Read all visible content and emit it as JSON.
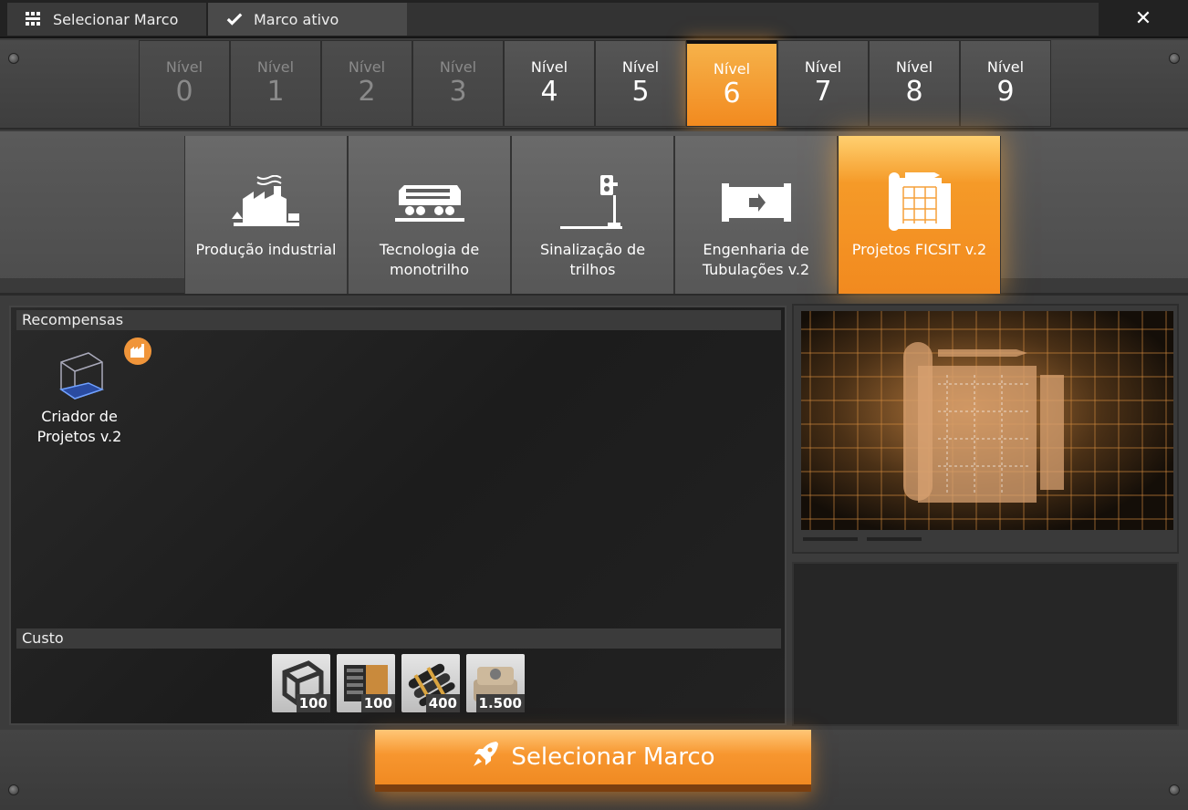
{
  "tabs": {
    "select_label": "Selecionar Marco",
    "active_label": "Marco ativo",
    "close_glyph": "✕"
  },
  "tiers": [
    {
      "label": "Nível",
      "number": "0",
      "state": "locked"
    },
    {
      "label": "Nível",
      "number": "1",
      "state": "locked"
    },
    {
      "label": "Nível",
      "number": "2",
      "state": "locked"
    },
    {
      "label": "Nível",
      "number": "3",
      "state": "locked"
    },
    {
      "label": "Nível",
      "number": "4",
      "state": "available"
    },
    {
      "label": "Nível",
      "number": "5",
      "state": "available"
    },
    {
      "label": "Nível",
      "number": "6",
      "state": "active"
    },
    {
      "label": "Nível",
      "number": "7",
      "state": "available"
    },
    {
      "label": "Nível",
      "number": "8",
      "state": "available"
    },
    {
      "label": "Nível",
      "number": "9",
      "state": "available"
    }
  ],
  "milestones": [
    {
      "label": "Produção industrial",
      "icon": "factory-icon"
    },
    {
      "label": "Tecnologia de monotrilho",
      "icon": "train-icon"
    },
    {
      "label": "Sinalização de trilhos",
      "icon": "signal-icon"
    },
    {
      "label": "Engenharia de Tubulações v.2",
      "icon": "pipe-icon"
    },
    {
      "label": "Projetos FICSIT v.2",
      "icon": "blueprint-icon",
      "active": true
    }
  ],
  "rewards": {
    "title": "Recompensas",
    "items": [
      {
        "label": "Criador de Projetos v.2",
        "icon": "blueprint-designer-icon",
        "badge_icon": "factory-badge-icon"
      }
    ]
  },
  "cost": {
    "title": "Custo",
    "items": [
      {
        "icon": "frame-icon",
        "quantity": "100"
      },
      {
        "icon": "computer-icon",
        "quantity": "100"
      },
      {
        "icon": "wire-icon",
        "quantity": "400"
      },
      {
        "icon": "concrete-icon",
        "quantity": "1.500"
      }
    ]
  },
  "select_button": {
    "label": "Selecionar Marco",
    "icon": "rocket-icon"
  },
  "colors": {
    "accent": "#f28a1f",
    "panel": "#1e1e1e"
  }
}
